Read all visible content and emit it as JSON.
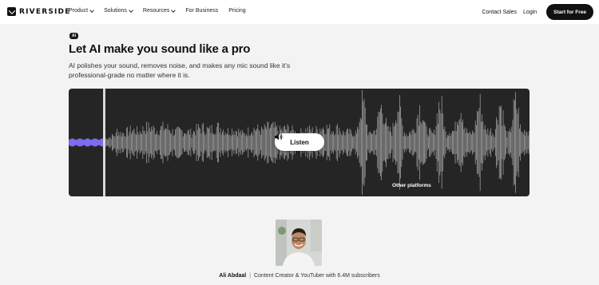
{
  "nav": {
    "logo": "RIVERSIDE",
    "links": [
      {
        "label": "Product",
        "dropdown": true
      },
      {
        "label": "Solutions",
        "dropdown": true
      },
      {
        "label": "Resources",
        "dropdown": true
      },
      {
        "label": "For Business",
        "dropdown": false
      },
      {
        "label": "Pricing",
        "dropdown": false
      }
    ],
    "contact": "Contact Sales",
    "login": "Login",
    "cta": "Start for Free"
  },
  "hero": {
    "badge": "AI",
    "title": "Let AI make you sound like a pro",
    "subtitle": "AI polishes your sound, removes noise, and makes any mic sound like it’s professional-grade no matter where it is."
  },
  "player": {
    "listen_label": "Listen",
    "platform_label": "Other platforms",
    "enhanced_color": "#7b6cf0",
    "waveform_color": "#9a9a9a",
    "background_color": "#252525"
  },
  "testimonial": {
    "name": "Ali Abdaal",
    "separator": "|",
    "role": "Content Creator & YouTuber with 6.4M subscribers"
  }
}
